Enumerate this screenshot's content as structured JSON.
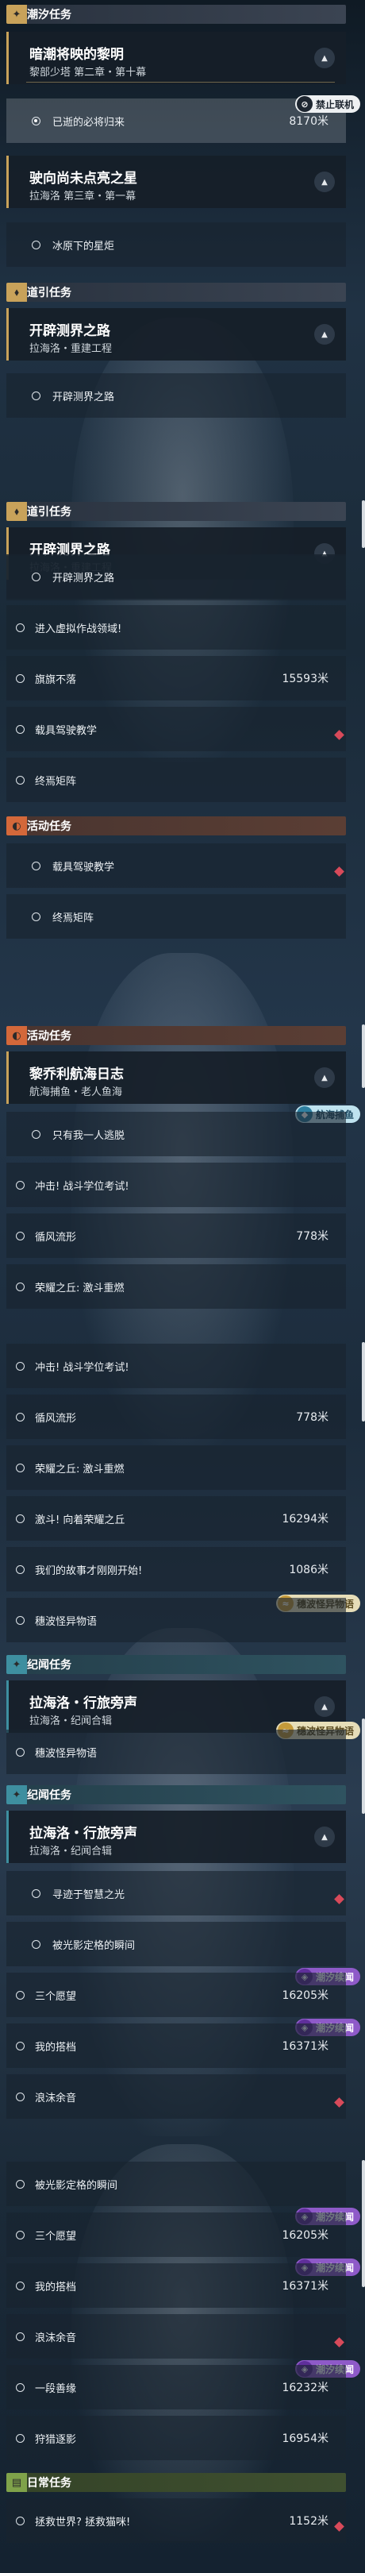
{
  "labels": {
    "tide_task": "潮汐任务",
    "guide_task": "道引任务",
    "activity_task": "活动任务",
    "chronicle_task": "纪闻任务",
    "daily_task": "日常任务"
  },
  "badges": {
    "no_coop": "禁止联机",
    "sea_catch": "航海捕鱼",
    "wave_tale": "穗波怪异物语",
    "tide_continue": "潮汐续闻"
  },
  "quests": {
    "dawn": {
      "title": "暗潮将映的黎明",
      "sub": "黎部少塔 第二章・第十幕"
    },
    "star": {
      "title": "驶向尚未点亮之星",
      "sub": "拉海洛 第三章・第一幕"
    },
    "path": {
      "title": "开辟测界之路",
      "sub": "拉海洛・重建工程"
    },
    "fishing": {
      "title": "黎乔利航海日志",
      "sub": "航海捕鱼・老人鱼海"
    },
    "travel": {
      "title": "拉海洛・行旅旁声",
      "sub": "拉海洛・纪闻合辑"
    }
  },
  "items": {
    "return": "已逝的必将归来",
    "return_dist": "8170米",
    "ice": "冰原下的星炬",
    "open": "开辟测界之路",
    "enter": "进入虚拟作战领域!",
    "flag": "旗旗不落",
    "flag_dist": "15593米",
    "carrier": "载具驾驶教学",
    "array": "终焉矩阵",
    "one": "只有我一人逃脱",
    "rush": "冲击! 战斗学位考试!",
    "rush_dist": "778米",
    "vortex": "循风流形",
    "glory": "荣耀之丘: 激斗重燃",
    "fight": "激斗! 向着荣耀之丘",
    "fight_dist": "16294米",
    "story": "我们的故事才刚刚开始!",
    "story_dist": "1086米",
    "wave": "穗波怪异物语",
    "seek": "寻迹于智慧之光",
    "shadow": "被光影定格的瞬间",
    "three": "三个愿望",
    "three_dist": "16205米",
    "partner": "我的搭档",
    "partner_dist": "16371米",
    "foam": "浪沫余音",
    "meet": "一段善缘",
    "meet_dist": "16232米",
    "sea": "狩猎逐影",
    "sea_dist": "16954米",
    "cat": "拯救世界? 拯救猫咪!",
    "cat_dist": "1152米"
  }
}
